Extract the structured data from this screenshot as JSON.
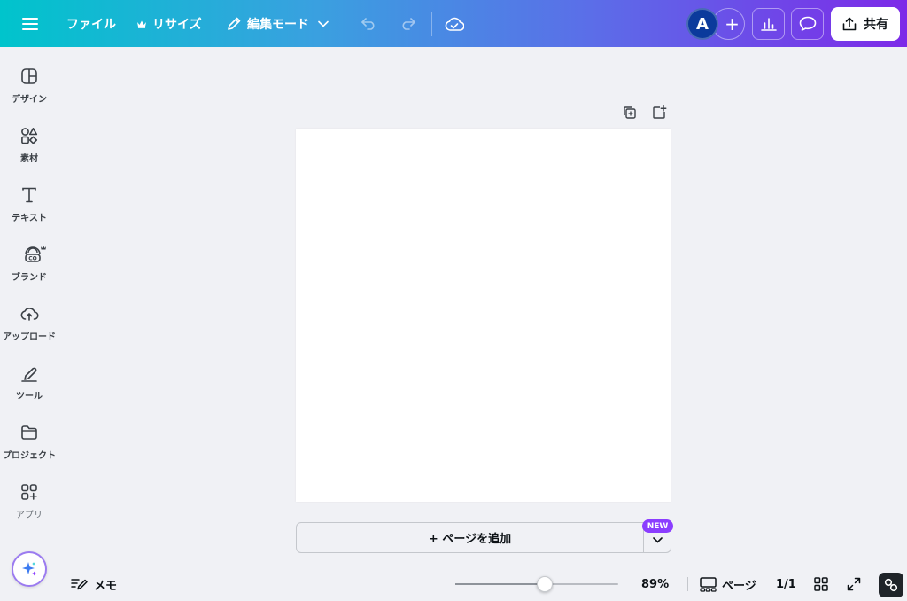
{
  "topbar": {
    "file_label": "ファイル",
    "resize_label": "リサイズ",
    "edit_mode_label": "編集モード",
    "avatar_initial": "A",
    "share_label": "共有"
  },
  "sidebar": {
    "items": [
      {
        "label": "デザイン",
        "icon": "design-icon"
      },
      {
        "label": "素材",
        "icon": "elements-icon"
      },
      {
        "label": "テキスト",
        "icon": "text-icon"
      },
      {
        "label": "ブランド",
        "icon": "brand-icon"
      },
      {
        "label": "アップロード",
        "icon": "upload-icon"
      },
      {
        "label": "ツール",
        "icon": "tools-icon"
      },
      {
        "label": "プロジェクト",
        "icon": "projects-icon"
      },
      {
        "label": "アプリ",
        "icon": "apps-icon"
      }
    ]
  },
  "canvas": {
    "add_page_label": "+ ページを追加",
    "new_badge": "NEW"
  },
  "bottombar": {
    "notes_label": "メモ",
    "zoom_value": "89%",
    "zoom_fraction": 0.55,
    "pages_label": "ページ",
    "page_count": "1/1"
  },
  "colors": {
    "accent": "#8b3dff",
    "gradient_start": "#00c4cc",
    "gradient_end": "#7d2ae8",
    "avatar": "#0b3a9c"
  }
}
